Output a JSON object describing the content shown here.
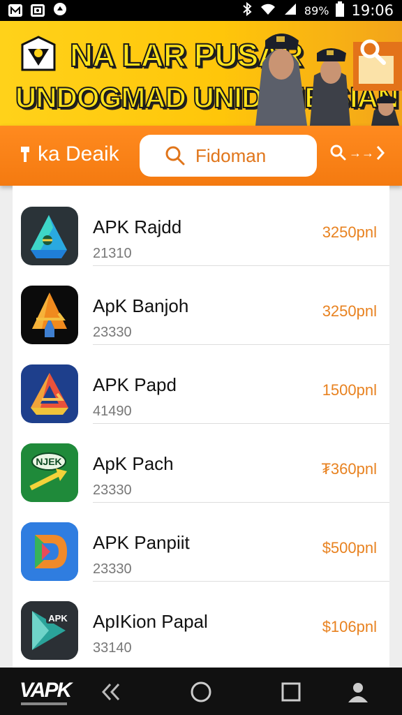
{
  "status_bar": {
    "battery": "89%",
    "time": "19:06"
  },
  "banner": {
    "line1": "NA LAR PUSAR",
    "line2": "UNDOGMAD UNIDONE SIAN"
  },
  "search_bar": {
    "brand": "ka Deaik",
    "search_text": "Fidoman",
    "more_glyph": "→→"
  },
  "apps": [
    {
      "name": "APK Rajdd",
      "count": "21310",
      "price": "3250pnl"
    },
    {
      "name": "ApK Banjoh",
      "count": "23330",
      "price": "3250pnl"
    },
    {
      "name": "APK Papd",
      "count": "41490",
      "price": "1500pnl"
    },
    {
      "name": "ApK Pach",
      "count": "23330",
      "price": "₮360pnl"
    },
    {
      "name": "APK Panpiit",
      "count": "23330",
      "price": "$500pnl"
    },
    {
      "name": "ApIKion Papal",
      "count": "33140",
      "price": "$106pnl"
    }
  ],
  "app_icon_badges": [
    "NJEK",
    "APK"
  ],
  "nav": {
    "logo": "VAPK"
  },
  "colors": {
    "accent_orange": "#f47a10",
    "banner_yellow": "#ffd21a",
    "price_orange": "#e88220"
  },
  "icons": [
    "signal-icon",
    "wifi-icon",
    "battery-icon",
    "search-icon",
    "forward-icon",
    "back-icon",
    "home-icon",
    "recents-icon",
    "profile-icon"
  ]
}
